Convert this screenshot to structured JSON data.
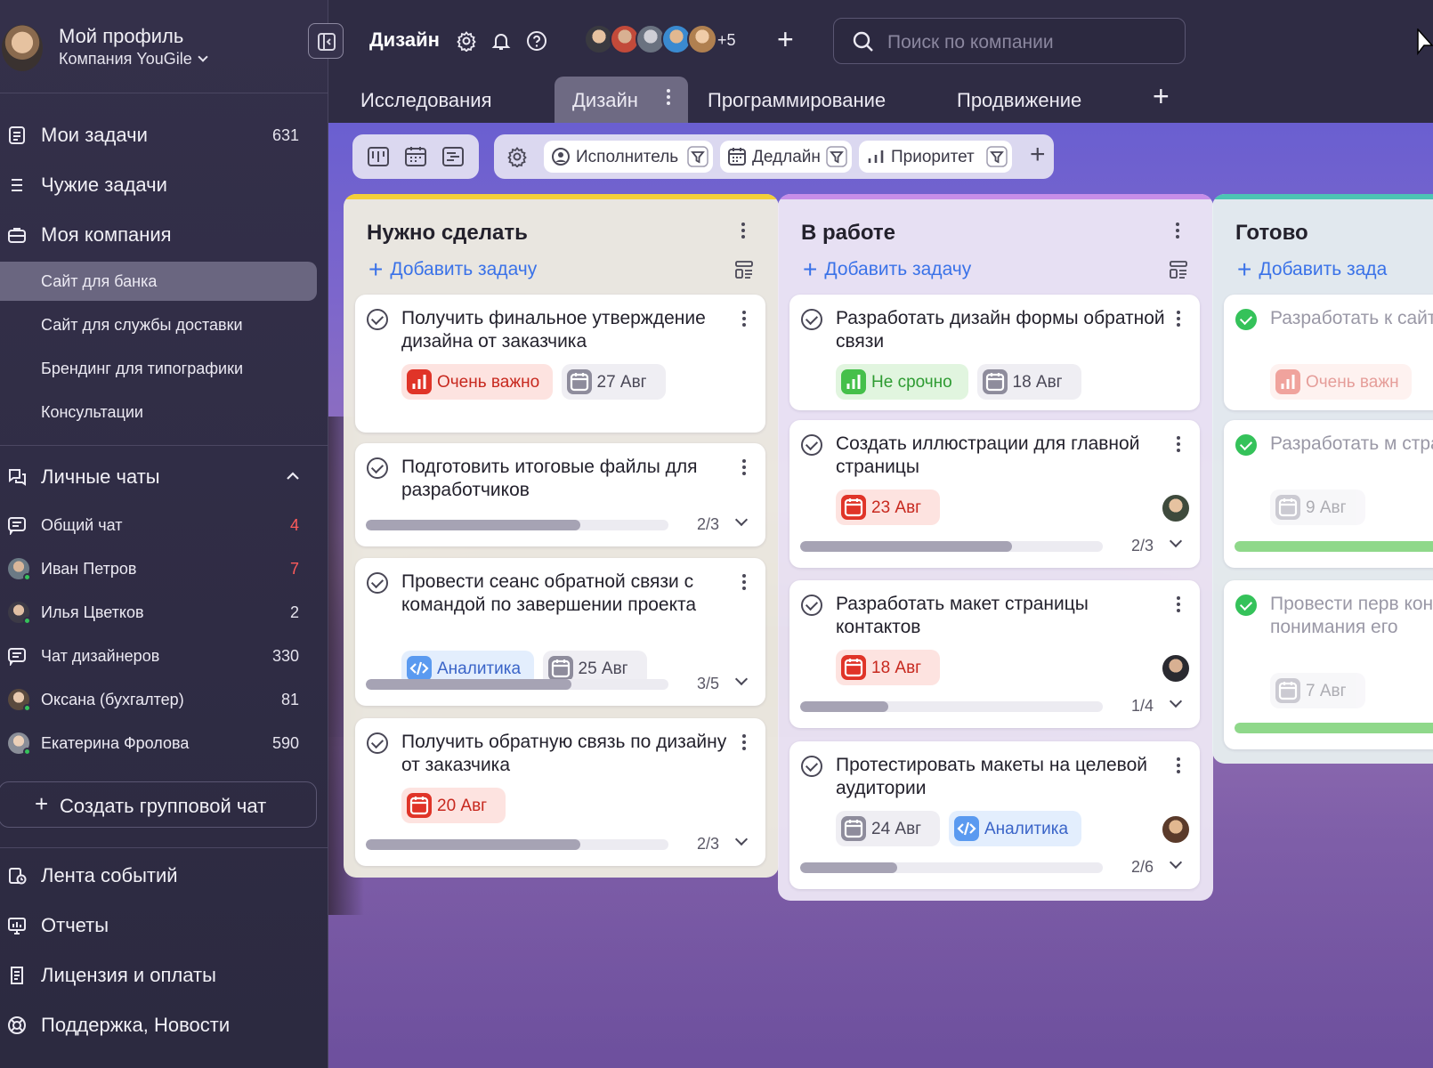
{
  "profile": {
    "name": "Мой профиль",
    "company": "Компания YouGile"
  },
  "nav": {
    "my_tasks": {
      "label": "Мои задачи",
      "count": "631"
    },
    "others_tasks": {
      "label": "Чужие задачи"
    },
    "my_company": {
      "label": "Моя компания"
    },
    "projects": [
      "Сайт для банка",
      "Сайт для службы доставки",
      "Брендинг для типографики",
      "Консультации"
    ],
    "personal_chats": {
      "label": "Личные чаты"
    },
    "chats": [
      {
        "name": "Общий чат",
        "count": "4",
        "unread": true
      },
      {
        "name": "Иван Петров",
        "count": "7",
        "unread": true
      },
      {
        "name": "Илья Цветков",
        "count": "2",
        "unread": false
      },
      {
        "name": "Чат дизайнеров",
        "count": "330",
        "unread": false
      },
      {
        "name": "Оксана (бухгалтер)",
        "count": "81",
        "unread": false
      },
      {
        "name": "Екатерина Фролова",
        "count": "590",
        "unread": false
      }
    ],
    "create_group_chat": "Создать групповой чат",
    "events_feed": "Лента событий",
    "reports": "Отчеты",
    "license": "Лицензия и оплаты",
    "support": "Поддержка, Новости"
  },
  "topbar": {
    "project_title": "Дизайн",
    "avatars_more": "+5",
    "search_placeholder": "Поиск по компании"
  },
  "tabs": [
    "Исследования",
    "Дизайн",
    "Программирование",
    "Продвижение"
  ],
  "active_tab": "Дизайн",
  "filters": {
    "assignee": "Исполнитель",
    "deadline": "Дедлайн",
    "priority": "Приоритет"
  },
  "columns": [
    {
      "title": "Нужно сделать",
      "add_label": "Добавить задачу",
      "color": "#f3cf3a",
      "cards": [
        {
          "title": "Получить финальное утверждение дизайна от заказчика",
          "tags": [
            {
              "style": "red",
              "icon": "priority-icon",
              "text": "Очень важно"
            },
            {
              "style": "gray",
              "icon": "calendar-icon",
              "text": "27 Авг"
            }
          ]
        },
        {
          "title": "Подготовить итоговые файлы для разработчиков",
          "progress": "2/3",
          "progress_value": 0.71
        },
        {
          "title": "Провести сеанс обратной связи с командой по завершении проекта",
          "tags": [
            {
              "style": "blue",
              "icon": "code-icon",
              "text": "Аналитика"
            },
            {
              "style": "gray",
              "icon": "calendar-icon",
              "text": "25 Авг"
            }
          ],
          "progress": "3/5",
          "progress_value": 0.68
        },
        {
          "title": "Получить обратную связь по дизайну от заказчика",
          "tags": [
            {
              "style": "red",
              "icon": "calendar-icon",
              "text": "20 Авг"
            }
          ],
          "progress": "2/3",
          "progress_value": 0.71
        }
      ]
    },
    {
      "title": "В работе",
      "add_label": "Добавить задачу",
      "color": "#c78ee8",
      "cards": [
        {
          "title": "Разработать дизайн формы обратной связи",
          "tags": [
            {
              "style": "green",
              "icon": "priority-icon",
              "text": "Не срочно"
            },
            {
              "style": "gray",
              "icon": "calendar-icon",
              "text": "18 Авг"
            }
          ]
        },
        {
          "title": "Создать иллюстрации для главной страницы",
          "tags": [
            {
              "style": "red",
              "icon": "calendar-icon",
              "text": "23 Авг"
            }
          ],
          "progress": "2/3",
          "progress_value": 0.7
        },
        {
          "title": "Разработать макет страницы контактов",
          "tags": [
            {
              "style": "red",
              "icon": "calendar-icon",
              "text": "18 Авг"
            }
          ],
          "progress": "1/4",
          "progress_value": 0.29
        },
        {
          "title": "Протестировать макеты на целевой аудитории",
          "tags": [
            {
              "style": "gray",
              "icon": "calendar-icon",
              "text": "24 Авг"
            },
            {
              "style": "blue",
              "icon": "code-icon",
              "text": "Аналитика"
            }
          ],
          "progress": "2/6",
          "progress_value": 0.32
        }
      ]
    },
    {
      "title": "Готово",
      "add_label": "Добавить зада",
      "color": "#4cc4b4",
      "cards": [
        {
          "title": "Разработать к сайта",
          "done": true,
          "tags": [
            {
              "style": "red",
              "icon": "priority-icon",
              "text": "Очень важн"
            }
          ]
        },
        {
          "title": "Разработать м страницы",
          "done": true,
          "tags": [
            {
              "style": "gray",
              "icon": "calendar-icon",
              "text": "9 Авг"
            }
          ]
        },
        {
          "title": "Провести перв консультации понимания его",
          "done": true,
          "tags": [
            {
              "style": "gray",
              "icon": "calendar-icon",
              "text": "7 Авг"
            }
          ]
        }
      ]
    }
  ]
}
